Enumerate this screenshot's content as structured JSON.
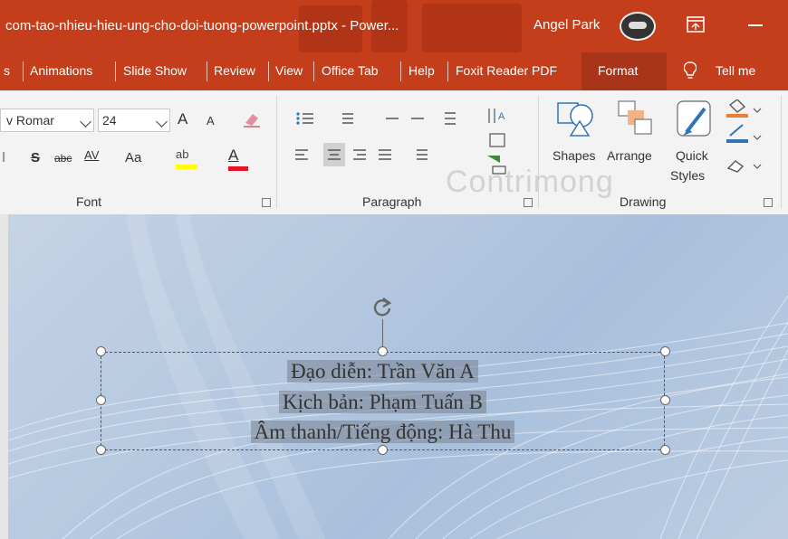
{
  "window": {
    "doc_title": "com-tao-nhieu-hieu-ung-cho-doi-tuong-powerpoint.pptx  -  Power...",
    "user_name": "Angel Park"
  },
  "tabs": [
    {
      "label": "s"
    },
    {
      "label": "Animations"
    },
    {
      "label": "Slide Show"
    },
    {
      "label": "Review"
    },
    {
      "label": "View"
    },
    {
      "label": "Office Tab"
    },
    {
      "label": "Help"
    },
    {
      "label": "Foxit Reader PDF"
    },
    {
      "label": "Format"
    },
    {
      "label": "Tell me"
    }
  ],
  "ribbon": {
    "font": {
      "group_label": "Font",
      "font_name": "v Romar",
      "font_size": "24",
      "grow": "A",
      "shrink": "A",
      "strike": "abc",
      "spacing": "AV",
      "case": "Aa",
      "shadow": "S",
      "color_letter": "A",
      "color_hex": "#e81123",
      "highlight_letter": "ab",
      "highlight_hex": "#ffff00"
    },
    "paragraph": {
      "group_label": "Paragraph"
    },
    "drawing": {
      "group_label": "Drawing",
      "shapes_label": "Shapes",
      "arrange_label": "Arrange",
      "quick_label": "Quick",
      "styles_label": "Styles",
      "fill_color": "#ed7d31",
      "outline_color": "#2e75b6"
    }
  },
  "watermark": "Contrimong",
  "slide": {
    "lines": [
      "Đạo diễn: Trần Văn A",
      "Kịch bản: Phạm Tuấn B",
      "Âm thanh/Tiếng động: Hà Thu"
    ]
  },
  "colors": {
    "accent": "#c43e1c",
    "format_tab": "#a8341a"
  }
}
